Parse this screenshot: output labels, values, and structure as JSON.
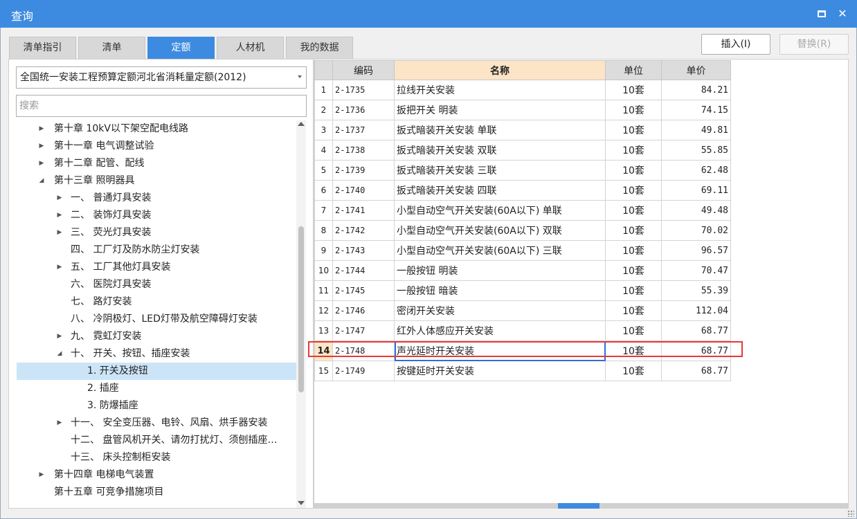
{
  "window": {
    "title": "查询",
    "maximize_label": "",
    "close_label": "✕"
  },
  "tabs": [
    {
      "label": "清单指引",
      "active": false
    },
    {
      "label": "清单",
      "active": false
    },
    {
      "label": "定额",
      "active": true
    },
    {
      "label": "人材机",
      "active": false
    },
    {
      "label": "我的数据",
      "active": false
    }
  ],
  "toolbar": {
    "insert_label": "插入(I)",
    "replace_label": "替换(R)"
  },
  "library_select": {
    "value": "全国统一安装工程预算定额河北省消耗量定额(2012)"
  },
  "search": {
    "placeholder": "搜索"
  },
  "tree": [
    {
      "label": "第十章 10kV以下架空配电线路",
      "arrow": "▶"
    },
    {
      "label": "第十一章 电气调整试验",
      "arrow": "▶"
    },
    {
      "label": "第十二章 配管、配线",
      "arrow": "▶"
    },
    {
      "label": "第十三章 照明器具",
      "arrow": "◢"
    },
    {
      "label": "一、 普通灯具安装",
      "arrow": "▶"
    },
    {
      "label": "二、 装饰灯具安装",
      "arrow": "▶"
    },
    {
      "label": "三、 荧光灯具安装",
      "arrow": "▶"
    },
    {
      "label": "四、 工厂灯及防水防尘灯安装",
      "arrow": ""
    },
    {
      "label": "五、 工厂其他灯具安装",
      "arrow": "▶"
    },
    {
      "label": "六、 医院灯具安装",
      "arrow": ""
    },
    {
      "label": "七、 路灯安装",
      "arrow": ""
    },
    {
      "label": "八、 冷阴极灯、LED灯带及航空障碍灯安装",
      "arrow": ""
    },
    {
      "label": "九、 霓虹灯安装",
      "arrow": "▶"
    },
    {
      "label": "十、 开关、按钮、插座安装",
      "arrow": "◢"
    },
    {
      "label": "1. 开关及按钮",
      "arrow": "",
      "selected": true
    },
    {
      "label": "2. 插座",
      "arrow": ""
    },
    {
      "label": "3. 防爆插座",
      "arrow": ""
    },
    {
      "label": "十一、 安全变压器、电铃、风扇、烘手器安装",
      "arrow": "▶"
    },
    {
      "label": "十二、 盘管风机开关、请勿打扰灯、须刨插座…",
      "arrow": ""
    },
    {
      "label": "十三、 床头控制柜安装",
      "arrow": ""
    },
    {
      "label": "第十四章 电梯电气装置",
      "arrow": "▶"
    },
    {
      "label": "第十五章 可竞争措施项目",
      "arrow": ""
    }
  ],
  "table": {
    "columns": [
      "编码",
      "名称",
      "单位",
      "单价"
    ],
    "rows": [
      {
        "idx": "1",
        "code": "2-1735",
        "name": "拉线开关安装",
        "unit": "10套",
        "price": "84.21"
      },
      {
        "idx": "2",
        "code": "2-1736",
        "name": "扳把开关 明装",
        "unit": "10套",
        "price": "74.15"
      },
      {
        "idx": "3",
        "code": "2-1737",
        "name": "扳式暗装开关安装 单联",
        "unit": "10套",
        "price": "49.81"
      },
      {
        "idx": "4",
        "code": "2-1738",
        "name": "扳式暗装开关安装 双联",
        "unit": "10套",
        "price": "55.85"
      },
      {
        "idx": "5",
        "code": "2-1739",
        "name": "扳式暗装开关安装 三联",
        "unit": "10套",
        "price": "62.48"
      },
      {
        "idx": "6",
        "code": "2-1740",
        "name": "扳式暗装开关安装 四联",
        "unit": "10套",
        "price": "69.11"
      },
      {
        "idx": "7",
        "code": "2-1741",
        "name": "小型自动空气开关安装(60A以下) 单联",
        "unit": "10套",
        "price": "49.48"
      },
      {
        "idx": "8",
        "code": "2-1742",
        "name": "小型自动空气开关安装(60A以下) 双联",
        "unit": "10套",
        "price": "70.02"
      },
      {
        "idx": "9",
        "code": "2-1743",
        "name": "小型自动空气开关安装(60A以下) 三联",
        "unit": "10套",
        "price": "96.57"
      },
      {
        "idx": "10",
        "code": "2-1744",
        "name": "一般按钮 明装",
        "unit": "10套",
        "price": "70.47"
      },
      {
        "idx": "11",
        "code": "2-1745",
        "name": "一般按钮 暗装",
        "unit": "10套",
        "price": "55.39"
      },
      {
        "idx": "12",
        "code": "2-1746",
        "name": "密闭开关安装",
        "unit": "10套",
        "price": "112.04"
      },
      {
        "idx": "13",
        "code": "2-1747",
        "name": "红外人体感应开关安装",
        "unit": "10套",
        "price": "68.77"
      },
      {
        "idx": "14",
        "code": "2-1748",
        "name": "声光延时开关安装",
        "unit": "10套",
        "price": "68.77",
        "current": true
      },
      {
        "idx": "15",
        "code": "2-1749",
        "name": "按键延时开关安装",
        "unit": "10套",
        "price": "68.77"
      }
    ]
  },
  "colors": {
    "titlebar": "#3d8be0",
    "active_tab": "#3d8be0",
    "name_header": "#fce4c6",
    "tree_selected": "#cce4f7",
    "highlight_box": "#e53935",
    "focus_cell": "#2f6fd6"
  }
}
